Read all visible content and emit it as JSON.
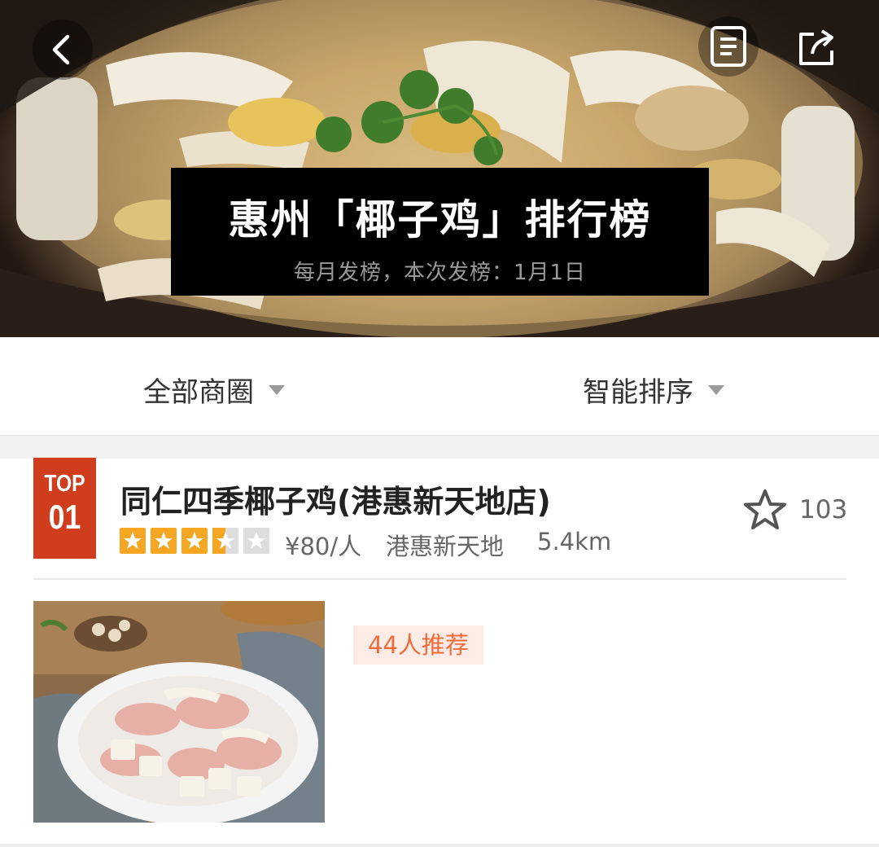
{
  "hero": {
    "title": "惠州「椰子鸡」排行榜",
    "subtitle": "每月发榜，本次发榜：1月1日",
    "icons": [
      "back-arrow-icon",
      "list-document-icon",
      "share-icon"
    ]
  },
  "filters": {
    "area": "全部商圈",
    "sort": "智能排序"
  },
  "shop": {
    "rank_top": "TOP",
    "rank_num": "01",
    "name": "同仁四季椰子鸡(港惠新天地店)",
    "rating_stars": 3.5,
    "price": "¥80/人",
    "area": "港惠新天地",
    "distance": "5.4km",
    "favorites": "103",
    "recommend": "44人推荐"
  },
  "colors": {
    "rank_badge": "#cf3d1c",
    "star_filled": "#f5a623",
    "star_empty": "#dddddd",
    "recommend_bg": "#fdece6",
    "recommend_text": "#f06a3a"
  }
}
